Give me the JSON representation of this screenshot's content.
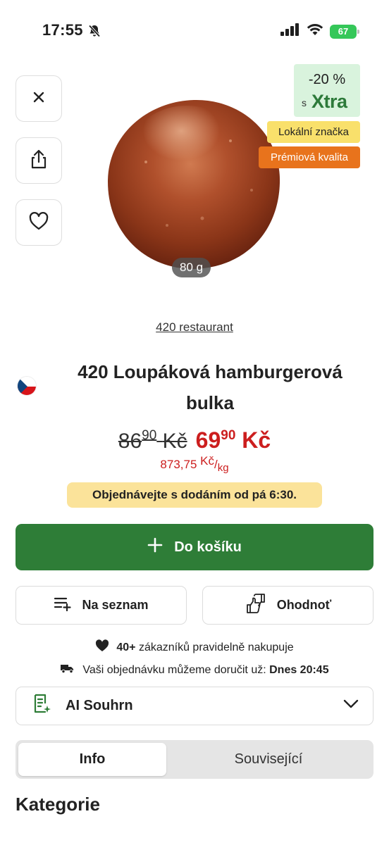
{
  "status_bar": {
    "time": "17:55",
    "battery": "67"
  },
  "product": {
    "weight": "80 g",
    "brand_link": "420 restaurant",
    "title_line1": "420 Loupáková hamburgerová",
    "title_line2": "bulka",
    "old_price_int": "86",
    "old_price_dec": "90",
    "old_price_cur": "Kč",
    "new_price_int": "69",
    "new_price_dec": "90",
    "new_price_cur": "Kč",
    "unit_price_value": "873,75",
    "unit_price_currency": "Kč",
    "unit_price_unit": "kg",
    "origin_flag": "czech-flag"
  },
  "badges": {
    "xtra_discount": "-20 %",
    "xtra_with": "s",
    "xtra_logo": "Xtra",
    "local": "Lokální značka",
    "premium": "Prémiová kvalita"
  },
  "delivery_note": "Objednávejte s dodáním od pá 6:30.",
  "actions": {
    "add_to_cart": "Do košíku",
    "add_to_list": "Na seznam",
    "rate": "Ohodnoť"
  },
  "customers": {
    "count": "40+",
    "text": "zákazníků pravidelně nakupuje"
  },
  "eta": {
    "text": "Vaši objednávku můžeme doručit už:",
    "value": "Dnes 20:45"
  },
  "ai_summary": {
    "label": "AI Souhrn"
  },
  "tabs": [
    {
      "label": "Info"
    },
    {
      "label": "Související"
    }
  ],
  "section_heading": "Kategorie",
  "colors": {
    "primary_green": "#2e7d37",
    "price_red": "#cc1e1e",
    "note_yellow": "#fbe39a",
    "xtra_green_bg": "#d9f3dd",
    "premium_orange": "#e8731c"
  }
}
